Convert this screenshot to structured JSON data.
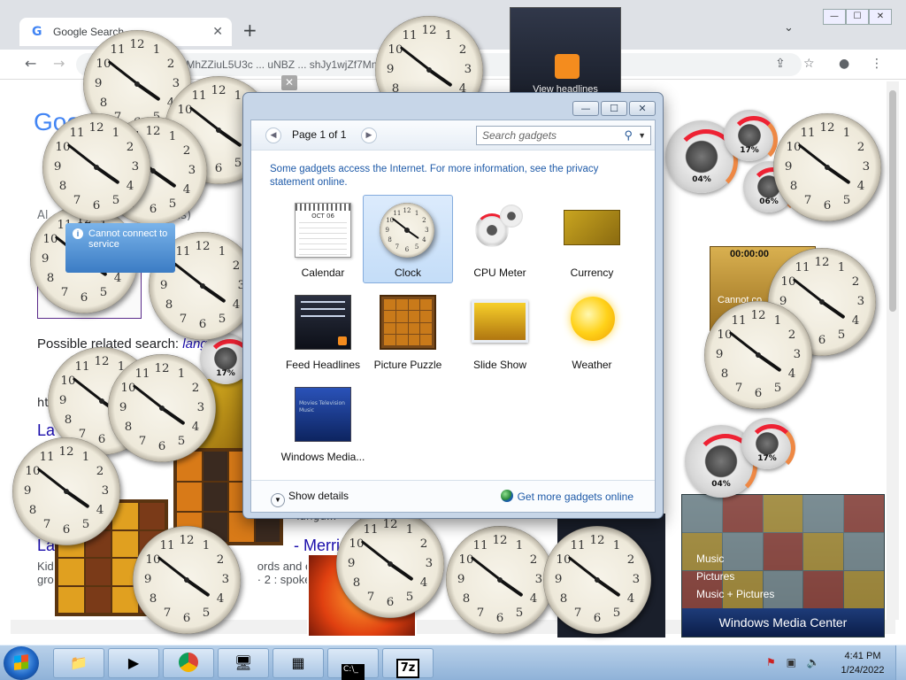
{
  "browser": {
    "tab_title": "Google Search",
    "new_tab": "+",
    "url": "om/search?tbs=sbi:AMhZZiuL5U3c ... uNBZ ... shJy1wjZf7Mnu9XKwe6Il...",
    "logo": "Goog",
    "related_prefix": "Possible related search: ",
    "related_term": "lang",
    "result_title": "La",
    "result_title2": "La",
    "result_suffix": "- Merria",
    "snippet": "Kid",
    "snippet2": "gro",
    "snippet_mid": "ords and exp",
    "snippet_mid2": "· 2 : spoken",
    "partial_ds": "Al",
    "partial_ds2": "ds)",
    "partial_http": "htt",
    "lang_text": "'langu..."
  },
  "desktop": {
    "rss_text": "View headlines",
    "connect_1": "Cannot connect to service",
    "connect_2": "Cannot co... to...",
    "ect_text": "ect",
    "timer_text": "00:00:00",
    "cpu_pct_1": "04%",
    "cpu_pct_2": "17%",
    "cpu_pct_3": "06%",
    "cpu_pct_4": "04%",
    "cpu_pct_5": "17%",
    "cpu_pct_6": "17%"
  },
  "gallery": {
    "page_label": "Page 1 of 1",
    "search_placeholder": "Search gadgets",
    "notice": "Some gadgets access the Internet.  For more information, see the privacy statement online.",
    "gadgets": [
      {
        "label": "Calendar",
        "selected": false
      },
      {
        "label": "Clock",
        "selected": true
      },
      {
        "label": "CPU Meter",
        "selected": false
      },
      {
        "label": "Currency",
        "selected": false
      },
      {
        "label": "Feed Headlines",
        "selected": false
      },
      {
        "label": "Picture Puzzle",
        "selected": false
      },
      {
        "label": "Slide Show",
        "selected": false
      },
      {
        "label": "Weather",
        "selected": false
      },
      {
        "label": "Windows Media...",
        "selected": false
      }
    ],
    "calendar_month": "OCT 06",
    "show_details": "Show details",
    "get_more": "Get more gadgets online",
    "wmc_icon_text": "Movies Television Music"
  },
  "media_center": {
    "menu": [
      "Music",
      "Pictures",
      "Music + Pictures"
    ],
    "title": "Windows Media Center"
  },
  "taskbar": {
    "time": "4:41 PM",
    "date": "1/24/2022",
    "sevenzip": "7z"
  },
  "clock_numbers": [
    "12",
    "1",
    "2",
    "3",
    "4",
    "5",
    "6",
    "7",
    "8",
    "9",
    "10",
    "11"
  ]
}
